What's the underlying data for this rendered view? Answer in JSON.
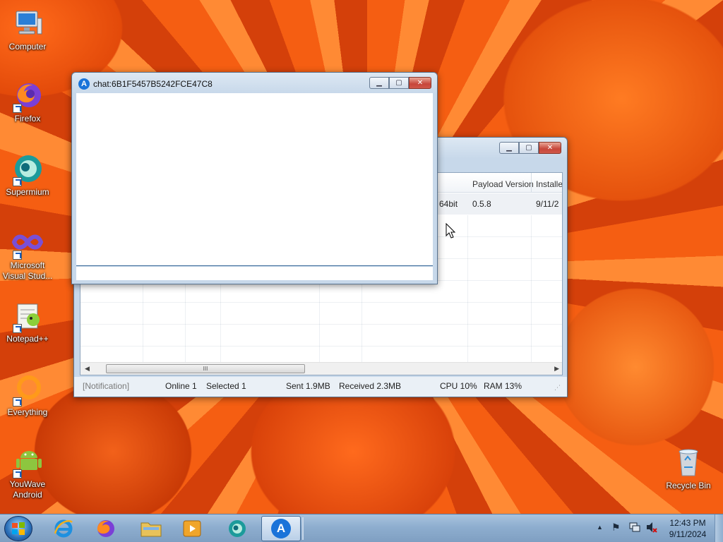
{
  "desktop_icons": [
    {
      "label": "Computer"
    },
    {
      "label": "Firefox"
    },
    {
      "label": "Supermium"
    },
    {
      "label": "Microsoft Visual Stud..."
    },
    {
      "label": "Notepad++"
    },
    {
      "label": "Everything"
    },
    {
      "label": "YouWave Android"
    },
    {
      "label": "Recycle Bin"
    }
  ],
  "chat_window": {
    "title": "chat:6B1F5457B5242FCE47C8",
    "message_input_value": ""
  },
  "main_window": {
    "columns": [
      "Payload Version",
      "Installe"
    ],
    "row": {
      "partial_cell": "e 64bit",
      "payload_version": "0.5.8",
      "installed": "9/11/2"
    },
    "scroll_grip": "III",
    "status": {
      "notification": "[Notification]",
      "online": "Online 1",
      "selected": "Selected 1",
      "sent": "Sent 1.9MB",
      "received": "Received 2.3MB",
      "cpu": "CPU 10%",
      "ram": "RAM 13%"
    }
  },
  "taskbar": {
    "clock_time": "12:43 PM",
    "clock_date": "9/11/2024",
    "show_hidden": "▲"
  },
  "colors": {
    "accent": "#1a73d9",
    "titlebar": "#c7d8ea",
    "close": "#c7463a"
  }
}
